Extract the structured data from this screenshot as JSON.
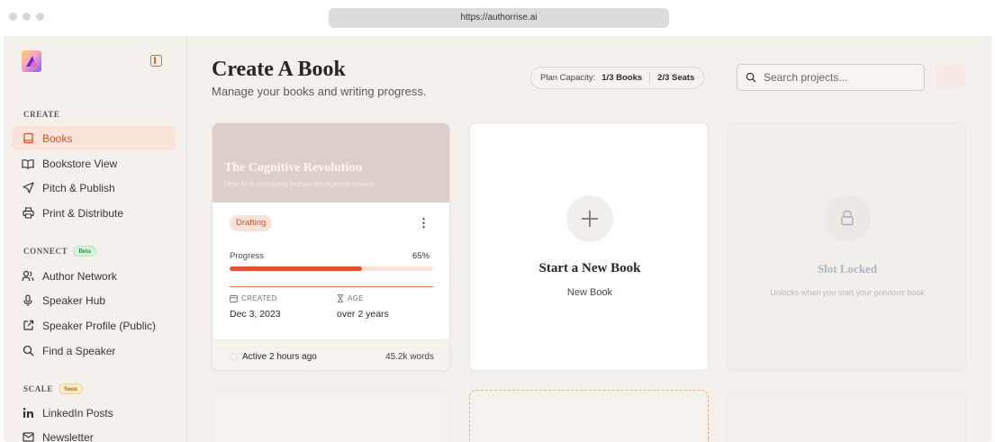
{
  "browser": {
    "url": "https://authorrise.ai"
  },
  "sidebar": {
    "sections": {
      "create": "CREATE",
      "connect": "CONNECT",
      "connect_badge": "Beta",
      "scale": "SCALE",
      "scale_badge": "Soon"
    },
    "items": [
      {
        "label": "Books",
        "icon": "book-icon",
        "active": true
      },
      {
        "label": "Bookstore View",
        "icon": "open-book-icon"
      },
      {
        "label": "Pitch & Publish",
        "icon": "send-icon"
      },
      {
        "label": "Print & Distribute",
        "icon": "printer-icon"
      },
      {
        "label": "Author Network",
        "icon": "users-icon"
      },
      {
        "label": "Speaker Hub",
        "icon": "microphone-icon"
      },
      {
        "label": "Speaker Profile (Public)",
        "icon": "external-link-icon"
      },
      {
        "label": "Find a Speaker",
        "icon": "search-icon"
      },
      {
        "label": "LinkedIn Posts",
        "icon": "linkedin-icon"
      },
      {
        "label": "Newsletter",
        "icon": "mail-icon"
      }
    ]
  },
  "header": {
    "title": "Create A Book",
    "subtitle": "Manage your books and writing progress.",
    "plan_label": "Plan Capacity:",
    "plan_books": "1/3 Books",
    "plan_seats": "2/3 Seats",
    "search_placeholder": "Search projects..."
  },
  "book_card": {
    "title": "The Cognitive Revolution",
    "subtitle": "How AI is reshaping human intelligence forever",
    "status": "Drafting",
    "progress_label": "Progress",
    "progress_text": "65%",
    "progress_value": 0.65,
    "created_label": "CREATED",
    "created_value": "Dec 3, 2023",
    "age_label": "AGE",
    "age_value": "over 2 years",
    "activity": "Active 2 hours ago",
    "words": "45.2k words"
  },
  "new_card": {
    "title": "Start a New Book",
    "subtitle": "New Book"
  },
  "locked_card": {
    "title": "Slot Locked",
    "subtitle": "Unlocks when you start your previous book"
  },
  "colors": {
    "accent": "#e0523a",
    "active_bg": "#f9e3da",
    "background": "#f4f1ec"
  }
}
